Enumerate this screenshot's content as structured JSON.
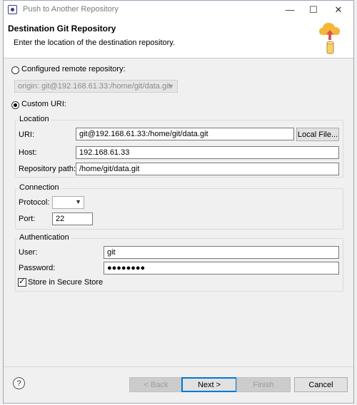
{
  "window": {
    "title": "Push to Another Repository",
    "minimize_glyph": "—",
    "maximize_glyph": "☐",
    "close_glyph": "✕"
  },
  "header": {
    "title": "Destination Git Repository",
    "description": "Enter the location of the destination repository."
  },
  "configured_remote": {
    "label": "Configured remote repository:",
    "value": "origin: git@192.168.61.33:/home/git/data.git",
    "selected": false
  },
  "custom_uri": {
    "label": "Custom URI:",
    "selected": true
  },
  "location": {
    "group_label": "Location",
    "uri_label": "URI:",
    "uri_value": "git@192.168.61.33:/home/git/data.git",
    "local_file_button": "Local File...",
    "host_label": "Host:",
    "host_value": "192.168.61.33",
    "path_label": "Repository path:",
    "path_value": "/home/git/data.git"
  },
  "connection": {
    "group_label": "Connection",
    "protocol_label": "Protocol:",
    "protocol_value": "",
    "port_label": "Port:",
    "port_value": "22"
  },
  "authentication": {
    "group_label": "Authentication",
    "user_label": "User:",
    "user_value": "git",
    "password_label": "Password:",
    "password_value": "●●●●●●●●",
    "store_label": "Store in Secure Store",
    "store_checked": true
  },
  "buttons": {
    "help_glyph": "?",
    "back": "< Back",
    "next": "Next >",
    "finish": "Finish",
    "cancel": "Cancel"
  },
  "icons": {
    "app": "eclipse-icon",
    "header": "cloud-upload-icon",
    "help": "help-icon"
  },
  "colors": {
    "accent": "#0078d7",
    "cloud": "#f5b63a",
    "arrow": "#d9534f"
  }
}
